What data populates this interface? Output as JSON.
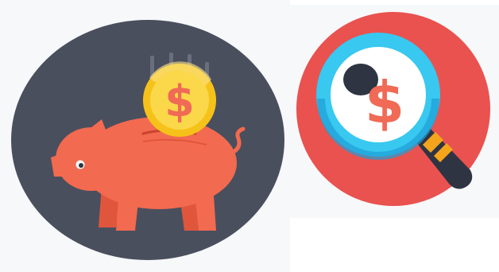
{
  "colors": {
    "dark_circle": "#4a4f5e",
    "pig": "#f26a4f",
    "pig_shade": "#e0563c",
    "coin": "#f6c21a",
    "coin_inner": "#fbd84a",
    "coin_symbol": "#f06a55",
    "red_circle": "#e9524f",
    "lens_ring": "#38c8f0",
    "lens_ring_dark": "#1f9ed6",
    "lens_glass": "#ffffff",
    "handle": "#2f3442",
    "handle_band": "#f4a51c"
  },
  "icons": {
    "left": "piggy-bank-icon",
    "right": "money-search-icon"
  },
  "symbols": {
    "coin": "$",
    "magnifier": "$"
  }
}
